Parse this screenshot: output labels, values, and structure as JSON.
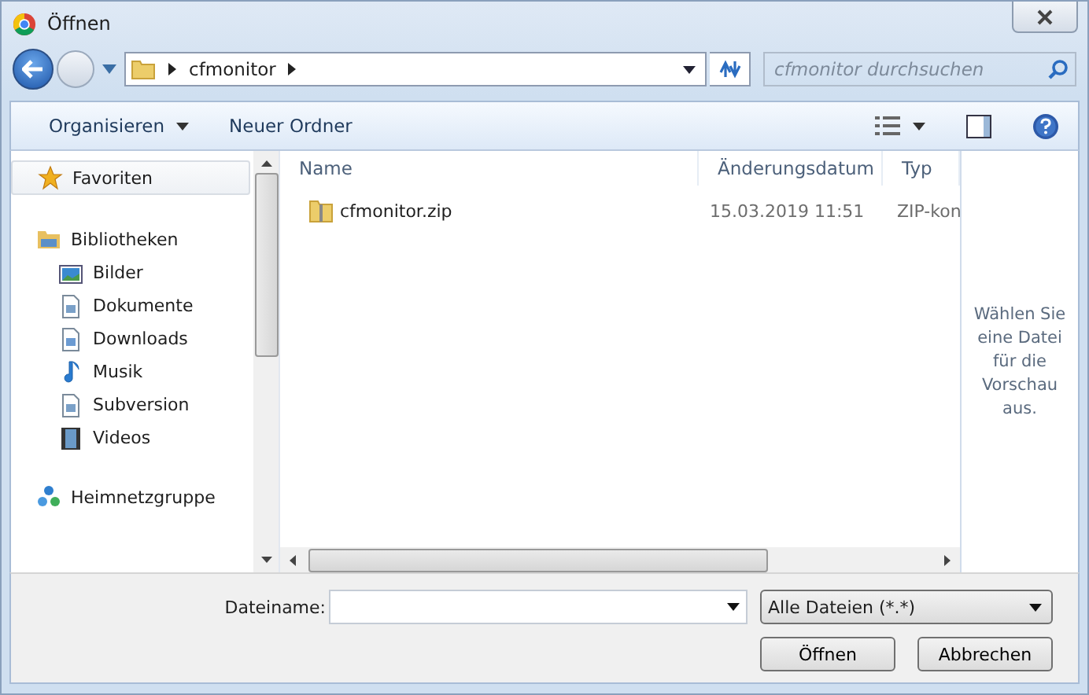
{
  "window": {
    "title": "Öffnen"
  },
  "address": {
    "segments": [
      "cfmonitor"
    ]
  },
  "search": {
    "placeholder": "cfmonitor durchsuchen"
  },
  "toolbar": {
    "organize": "Organisieren",
    "new_folder": "Neuer Ordner"
  },
  "sidebar": {
    "items": [
      {
        "label": "Favoriten",
        "kind": "star",
        "selected": true
      },
      {
        "label": "Bibliotheken",
        "kind": "library",
        "selected": false,
        "children": [
          {
            "label": "Bilder",
            "kind": "pictures",
            "selected": false
          },
          {
            "label": "Dokumente",
            "kind": "documents",
            "selected": false
          },
          {
            "label": "Downloads",
            "kind": "downloads",
            "selected": false
          },
          {
            "label": "Musik",
            "kind": "music",
            "selected": false
          },
          {
            "label": "Subversion",
            "kind": "documents",
            "selected": false
          },
          {
            "label": "Videos",
            "kind": "videos",
            "selected": false
          }
        ]
      },
      {
        "label": "Heimnetzgruppe",
        "kind": "network",
        "selected": false
      }
    ]
  },
  "table": {
    "columns": [
      "Name",
      "Änderungsdatum",
      "Typ"
    ],
    "rows": [
      {
        "name": "cfmonitor.zip",
        "date": "15.03.2019 11:51",
        "type": "ZIP-kon"
      }
    ]
  },
  "preview": {
    "text": "Wählen Sie eine Datei für die Vorschau aus."
  },
  "footer": {
    "filename_label": "Dateiname:",
    "filter": "Alle Dateien (*.*)",
    "buttons": [
      "Öffnen",
      "Abbrechen"
    ]
  }
}
